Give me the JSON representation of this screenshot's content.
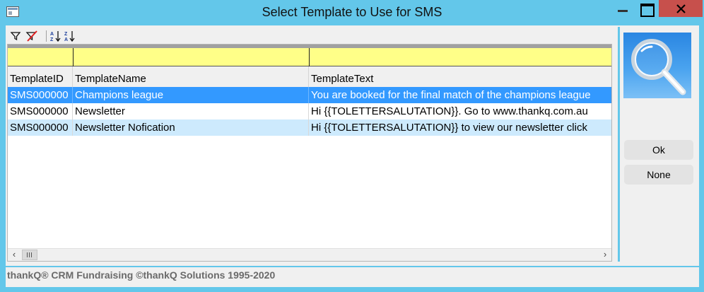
{
  "window": {
    "title": "Select Template to Use for SMS",
    "accent_color": "#63c7ea",
    "close_color": "#c7504c"
  },
  "toolbar": {
    "icons": [
      "filter-icon",
      "clear-filter-icon",
      "sort-ascending-icon",
      "sort-descending-icon"
    ]
  },
  "grid": {
    "filter_color": "#ffff88",
    "selection_color": "#3399ff",
    "alt_row_color": "#cdeafd",
    "columns": [
      "TemplateID",
      "TemplateName",
      "TemplateText"
    ],
    "rows": [
      {
        "id": "SMS000000",
        "name": "Champions league",
        "text": "You are booked for the final match of the champions league"
      },
      {
        "id": "SMS000000",
        "name": "Newsletter",
        "text": "Hi {{TOLETTERSALUTATION}}. Go to www.thankq.com.au"
      },
      {
        "id": "SMS000000",
        "name": "Newsletter Nofication",
        "text": "Hi {{TOLETTERSALUTATION}} to view our newsletter click"
      }
    ]
  },
  "side": {
    "search_icon": "magnifier-icon",
    "ok_label": "Ok",
    "none_label": "None"
  },
  "footer": {
    "text": "thankQ® CRM Fundraising ©thankQ Solutions 1995-2020"
  }
}
